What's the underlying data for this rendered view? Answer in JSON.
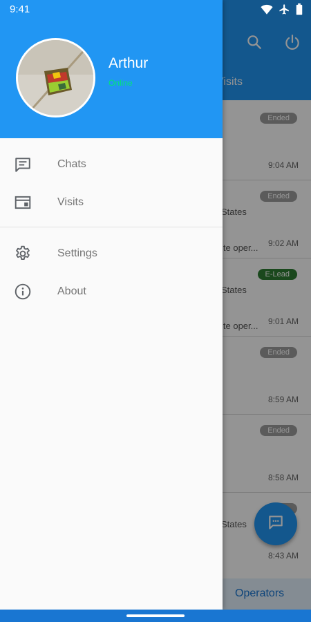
{
  "status_bar": {
    "time": "9:41",
    "icons": [
      "wifi-icon",
      "airplane-icon",
      "battery-icon"
    ]
  },
  "background": {
    "tab_label": "Visits",
    "rows": [
      {
        "badge": "Ended",
        "badge_type": "ended",
        "location": "",
        "description": "",
        "time": "9:04 AM"
      },
      {
        "badge": "Ended",
        "badge_type": "ended",
        "location": "States",
        "description": "ite oper...",
        "time": "9:02 AM"
      },
      {
        "badge": "E-Lead",
        "badge_type": "lead",
        "location": "States",
        "description": "ite oper...",
        "time": "9:01 AM"
      },
      {
        "badge": "Ended",
        "badge_type": "ended",
        "location": "",
        "description": "",
        "time": "8:59 AM"
      },
      {
        "badge": "Ended",
        "badge_type": "ended",
        "location": "",
        "description": "",
        "time": "8:58 AM"
      },
      {
        "badge": "",
        "badge_type": "ended",
        "location": "States",
        "description": "",
        "time": "8:43 AM"
      }
    ],
    "bottom_label": "Operators"
  },
  "drawer": {
    "user": {
      "name": "Arthur",
      "status": "Online"
    },
    "menu_primary": [
      {
        "label": "Chats",
        "icon": "chat-icon"
      },
      {
        "label": "Visits",
        "icon": "visits-icon"
      }
    ],
    "menu_secondary": [
      {
        "label": "Settings",
        "icon": "gear-icon"
      },
      {
        "label": "About",
        "icon": "info-icon"
      }
    ]
  },
  "colors": {
    "primary": "#2196f3",
    "status_online": "#00e676",
    "badge_ended": "#9e9e9e",
    "badge_lead": "#2e7d32"
  }
}
